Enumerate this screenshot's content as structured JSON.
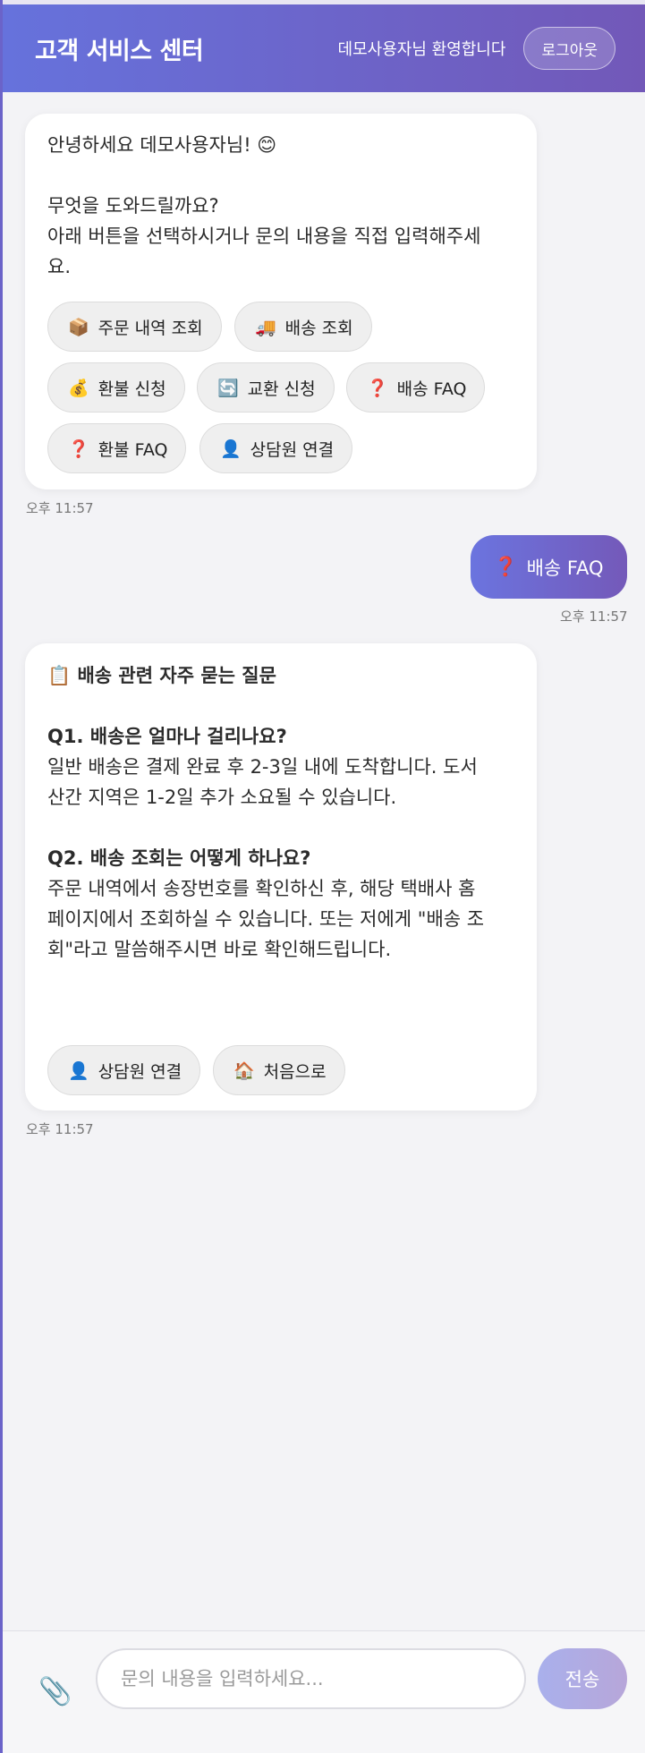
{
  "header": {
    "title": "고객 서비스 센터",
    "welcome": "데모사용자님 환영합니다",
    "logout_label": "로그아웃"
  },
  "messages": {
    "greeting": {
      "line1": "안녕하세요 데모사용자님! 😊",
      "line2": "무엇을 도와드릴까요?",
      "line3": "아래 버튼을 선택하시거나 문의 내용을 직접 입력해주세",
      "line4": "요.",
      "timestamp": "오후 11:57",
      "chips": [
        {
          "emoji": "📦",
          "label": "주문 내역 조회"
        },
        {
          "emoji": "🚚",
          "label": "배송 조회"
        },
        {
          "emoji": "💰",
          "label": "환불 신청"
        },
        {
          "emoji": "🔄",
          "label": "교환 신청"
        },
        {
          "emoji": "❓",
          "label": "배송 FAQ"
        },
        {
          "emoji": "❓",
          "label": "환불 FAQ"
        },
        {
          "emoji": "👤",
          "label": "상담원 연결"
        }
      ]
    },
    "user": {
      "emoji": "❓",
      "text": "배송 FAQ",
      "timestamp": "오후 11:57"
    },
    "faq": {
      "title_emoji": "📋",
      "title": "배송 관련 자주 묻는 질문",
      "q1": "Q1. 배송은 얼마나 걸리나요?",
      "a1_line1": "일반 배송은 결제 완료 후 2-3일 내에 도착합니다. 도서",
      "a1_line2": "산간 지역은 1-2일 추가 소요될 수 있습니다.",
      "q2": "Q2. 배송 조회는 어떻게 하나요?",
      "a2_line1": "주문 내역에서 송장번호를 확인하신 후, 해당 택배사 홈",
      "a2_line2": "페이지에서 조회하실 수 있습니다. 또는 저에게 \"배송 조",
      "a2_line3": "회\"라고 말씀해주시면 바로 확인해드립니다.",
      "timestamp": "오후 11:57",
      "chips": [
        {
          "emoji": "👤",
          "label": "상담원 연결"
        },
        {
          "emoji": "🏠",
          "label": "처음으로"
        }
      ]
    }
  },
  "input": {
    "attach_icon": "📎",
    "placeholder": "문의 내용을 입력하세요...",
    "send_label": "전송"
  }
}
